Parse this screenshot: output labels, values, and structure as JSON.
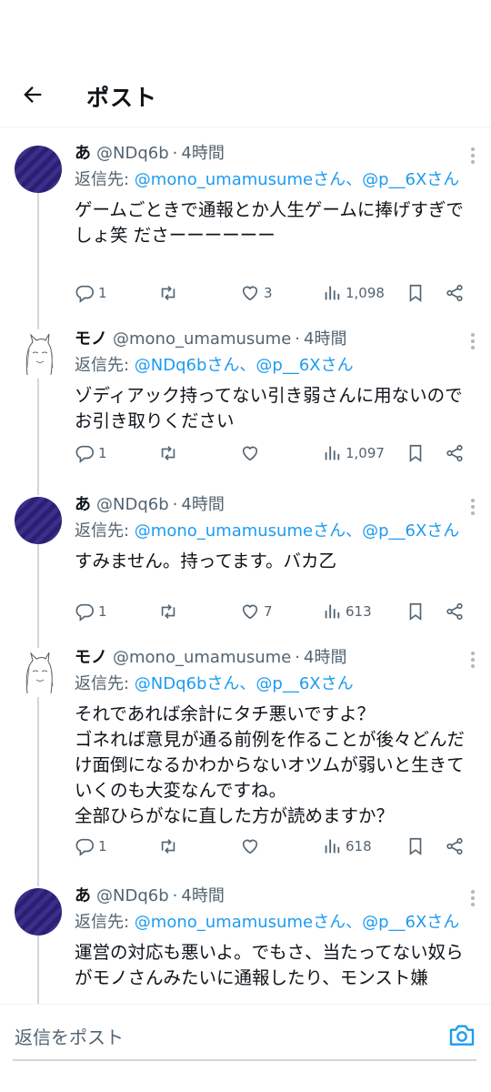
{
  "header": {
    "title": "ポスト"
  },
  "tweets": [
    {
      "name": "あ",
      "handle": "@NDq6b",
      "time": "4時間",
      "reply_prefix": "返信先: ",
      "reply_to": "@mono_umamusumeさん、@p__6Xさん",
      "text": "ゲームごときで通報とか人生ゲームに捧げすぎでしょ笑 ださーーーーーー",
      "replies": "1",
      "retweets": "",
      "likes": "3",
      "views": "1,098"
    },
    {
      "name": "モノ",
      "handle": "@mono_umamusume",
      "time": "4時間",
      "reply_prefix": "返信先: ",
      "reply_to": "@NDq6bさん、@p__6Xさん",
      "text": "ゾディアック持ってない引き弱さんに用ないのでお引き取りください",
      "replies": "1",
      "retweets": "",
      "likes": "",
      "views": "1,097"
    },
    {
      "name": "あ",
      "handle": "@NDq6b",
      "time": "4時間",
      "reply_prefix": "返信先: ",
      "reply_to": "@mono_umamusumeさん、@p__6Xさん",
      "text": "すみません。持ってます。バカ乙",
      "replies": "1",
      "retweets": "",
      "likes": "7",
      "views": "613"
    },
    {
      "name": "モノ",
      "handle": "@mono_umamusume",
      "time": "4時間",
      "reply_prefix": "返信先: ",
      "reply_to": "@NDq6bさん、@p__6Xさん",
      "text": "それであれば余計にタチ悪いですよ？\nゴネれば意見が通る前例を作ることが後々どんだけ面倒になるかわからないオツムが弱いと生きていくのも大変なんですね。\n全部ひらがなに直した方が読めますか？",
      "replies": "1",
      "retweets": "",
      "likes": "",
      "views": "618"
    },
    {
      "name": "あ",
      "handle": "@NDq6b",
      "time": "4時間",
      "reply_prefix": "返信先: ",
      "reply_to": "@mono_umamusumeさん、@p__6Xさん",
      "text": "運営の対応も悪いよ。でもさ、当たってない奴らがモノさんみたいに通報したり、モンスト嫌"
    }
  ],
  "compose": {
    "placeholder": "返信をポスト"
  },
  "icons": [
    "back-arrow-icon",
    "more-icon",
    "reply-icon",
    "retweet-icon",
    "like-icon",
    "views-icon",
    "bookmark-icon",
    "share-icon",
    "camera-icon"
  ],
  "colors": {
    "link": "#1d9bf0",
    "secondary": "#536471",
    "text": "#0f1419",
    "divider": "#eff3f4"
  }
}
